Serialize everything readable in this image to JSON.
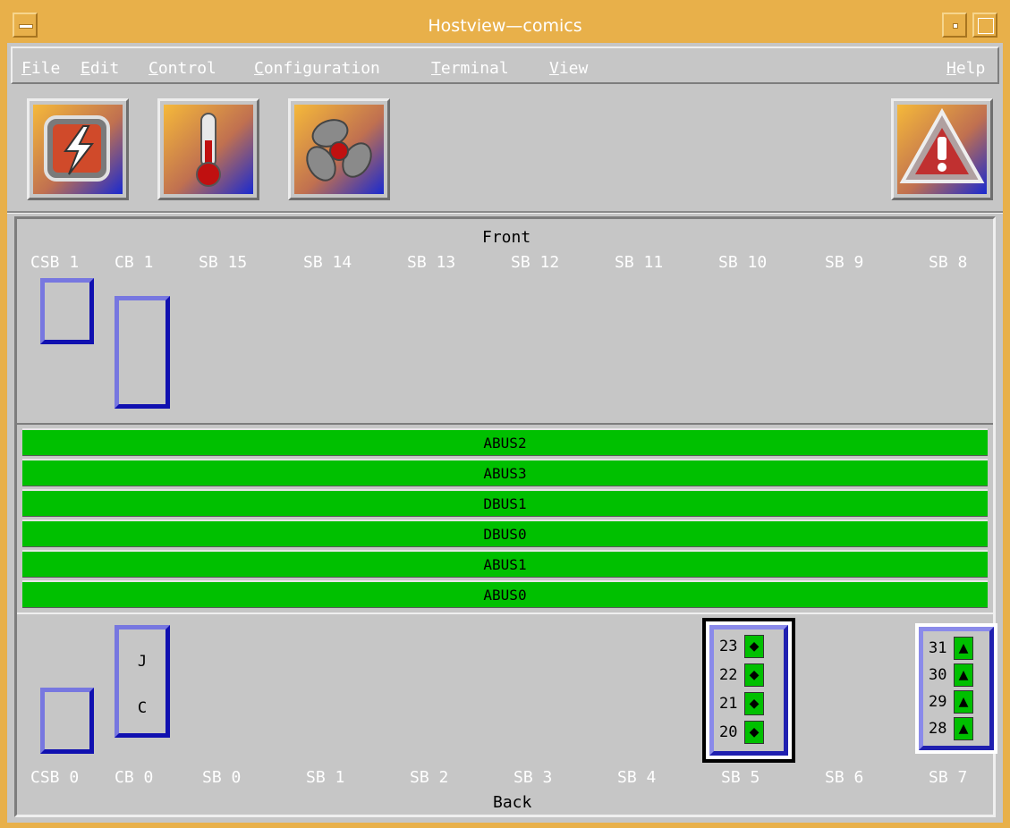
{
  "window": {
    "title": "Hostview—comics"
  },
  "menubar": {
    "items": [
      {
        "label": "File",
        "mnemonic": "F"
      },
      {
        "label": "Edit",
        "mnemonic": "E"
      },
      {
        "label": "Control",
        "mnemonic": "C"
      },
      {
        "label": "Configuration",
        "mnemonic": "C"
      },
      {
        "label": "Terminal",
        "mnemonic": "T"
      },
      {
        "label": "View",
        "mnemonic": "V"
      }
    ],
    "help": {
      "label": "Help",
      "mnemonic": "H"
    }
  },
  "toolbar": {
    "icons": [
      "power-icon",
      "thermometer-icon",
      "fan-icon",
      "warning-icon"
    ]
  },
  "panel": {
    "front_label": "Front",
    "back_label": "Back",
    "front_slots": [
      "CSB 1",
      "CB 1",
      "SB 15",
      "SB 14",
      "SB 13",
      "SB 12",
      "SB 11",
      "SB 10",
      "SB 9",
      "SB 8"
    ],
    "back_slots": [
      "CSB 0",
      "CB 0",
      "SB 0",
      "SB 1",
      "SB 2",
      "SB 3",
      "SB 4",
      "SB 5",
      "SB 6",
      "SB 7"
    ],
    "buses": [
      "ABUS2",
      "ABUS3",
      "DBUS1",
      "DBUS0",
      "ABUS1",
      "ABUS0"
    ],
    "cb0_letters": [
      "J",
      "C"
    ],
    "sb5": {
      "selected": true,
      "cpus": [
        {
          "id": "23",
          "status": "◆"
        },
        {
          "id": "22",
          "status": "◆"
        },
        {
          "id": "21",
          "status": "◆"
        },
        {
          "id": "20",
          "status": "◆"
        }
      ]
    },
    "sb7": {
      "selected": false,
      "cpus": [
        {
          "id": "31",
          "status": "▲"
        },
        {
          "id": "30",
          "status": "▲"
        },
        {
          "id": "29",
          "status": "▲"
        },
        {
          "id": "28",
          "status": "▲"
        }
      ]
    }
  },
  "colors": {
    "bus_green": "#00c000",
    "board_blue": "#2020b0",
    "title_bar": "#e8b04a",
    "background": "#c6c6c6"
  }
}
